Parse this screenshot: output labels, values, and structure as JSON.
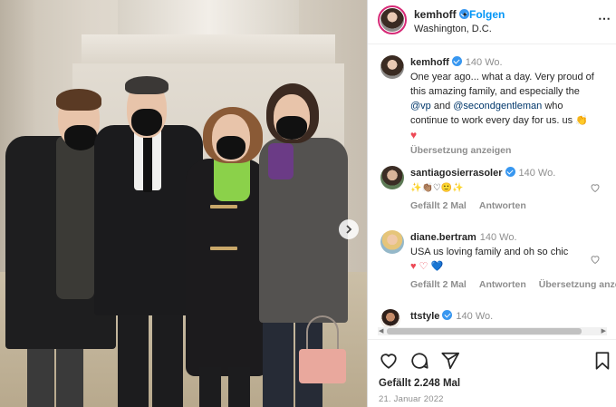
{
  "post_header": {
    "username": "kemhoff",
    "dot": "•",
    "follow_label": "Folgen",
    "location": "Washington, D.C.",
    "more_icon": "⋯"
  },
  "caption": {
    "username": "kemhoff",
    "time": "140 Wo.",
    "text_before": "One year ago... what a day. Very proud of this amazing family, and especially the ",
    "mention_1": "@vp",
    "text_and": " and ",
    "mention_2": "@secondgentleman",
    "text_after": " who continue to work every day for us. us 👏",
    "heart": "♥",
    "translate_label": "Übersetzung anzeigen"
  },
  "comments": [
    {
      "username": "santiagosierrasoler",
      "verified": true,
      "time": "140 Wo.",
      "text": "✨👏🏽♡🙂✨",
      "likes_label": "Gefällt 2 Mal",
      "reply_label": "Antworten",
      "translate_label": ""
    },
    {
      "username": "diane.bertram",
      "verified": false,
      "time": "140 Wo.",
      "text": "USA us loving family and oh so chic",
      "text2": "♥ ♡ 💙",
      "likes_label": "Gefällt 2 Mal",
      "reply_label": "Antworten",
      "translate_label": "Übersetzung anzeigen"
    },
    {
      "username": "ttstyle",
      "verified": true,
      "time": "140 Wo."
    }
  ],
  "footer": {
    "likes": "Gefällt 2.248 Mal",
    "date": "21. Januar 2022"
  },
  "colors": {
    "follow_blue": "#0095f6",
    "verified_blue": "#3897f0",
    "heart_red": "#ed4956",
    "mention": "#00376b"
  }
}
